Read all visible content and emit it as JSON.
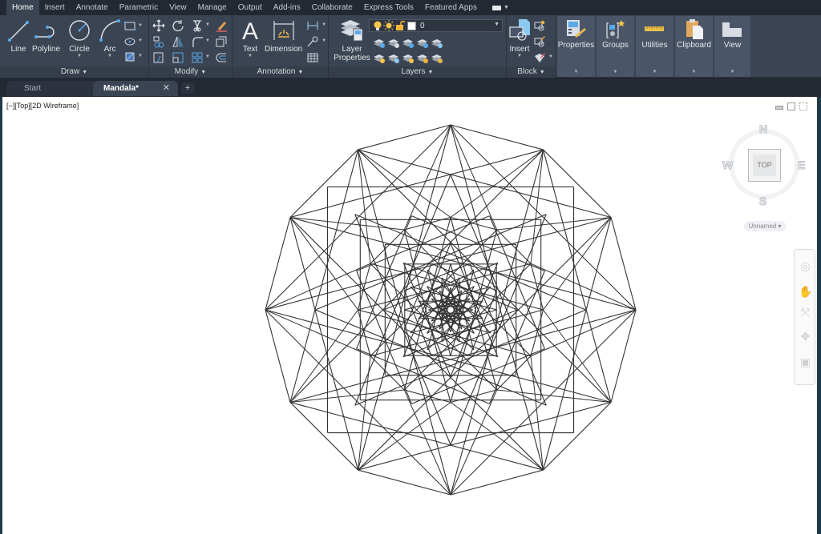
{
  "ribbon": {
    "tabs": [
      "Home",
      "Insert",
      "Annotate",
      "Parametric",
      "View",
      "Manage",
      "Output",
      "Add-ins",
      "Collaborate",
      "Express Tools",
      "Featured Apps"
    ],
    "active_tab": "Home",
    "panels": {
      "draw": {
        "title": "Draw",
        "buttons": [
          "Line",
          "Polyline",
          "Circle",
          "Arc"
        ]
      },
      "modify": {
        "title": "Modify"
      },
      "annotation": {
        "title": "Annotation",
        "buttons": [
          "Text",
          "Dimension"
        ]
      },
      "layers": {
        "title": "Layers",
        "layer_properties": "Layer Properties",
        "current_layer": "0",
        "current_layer_color": "#ffffff"
      },
      "block": {
        "title": "Block",
        "insert": "Insert"
      },
      "collapsed": [
        "Properties",
        "Groups",
        "Utilities",
        "Clipboard",
        "View"
      ]
    }
  },
  "file_tabs": {
    "start": "Start",
    "active": "Mandala*",
    "close_glyph": "✕",
    "new_glyph": "+"
  },
  "viewport": {
    "controls_label": "[−][Top][2D Wireframe]",
    "viewcube": {
      "face": "TOP",
      "north": "N",
      "south": "S",
      "east": "E",
      "west": "W",
      "ucs": "Unnamed"
    }
  },
  "drawing": {
    "name": "Mandala",
    "stroke_color": "#333333",
    "description": "Wireframe mandala: nested regular polygons (12, 8, 4 sides) with star diagonals converging toward the center",
    "layers": [
      {
        "sides": 12,
        "radius": 1.0,
        "rotation_deg": 0,
        "star_step": 1
      },
      {
        "sides": 12,
        "radius": 1.0,
        "rotation_deg": 0,
        "star_step": 3
      },
      {
        "sides": 12,
        "radius": 1.0,
        "rotation_deg": 0,
        "star_step": 5
      },
      {
        "sides": 4,
        "radius": 0.94,
        "rotation_deg": 45,
        "star_step": 1
      },
      {
        "sides": 8,
        "radius": 0.73,
        "rotation_deg": 0,
        "star_step": 3
      },
      {
        "sides": 4,
        "radius": 0.69,
        "rotation_deg": 45,
        "star_step": 1
      },
      {
        "sides": 8,
        "radius": 0.55,
        "rotation_deg": 22.5,
        "star_step": 2
      },
      {
        "sides": 12,
        "radius": 0.5,
        "rotation_deg": 0,
        "star_step": 1
      },
      {
        "sides": 12,
        "radius": 0.5,
        "rotation_deg": 0,
        "star_step": 5
      },
      {
        "sides": 4,
        "radius": 0.5,
        "rotation_deg": 45,
        "star_step": 1
      },
      {
        "sides": 8,
        "radius": 0.36,
        "rotation_deg": 0,
        "star_step": 3
      },
      {
        "sides": 4,
        "radius": 0.35,
        "rotation_deg": 45,
        "star_step": 1
      },
      {
        "sides": 8,
        "radius": 0.27,
        "rotation_deg": 22.5,
        "star_step": 2
      },
      {
        "sides": 12,
        "radius": 0.25,
        "rotation_deg": 0,
        "star_step": 5
      },
      {
        "sides": 12,
        "radius": 0.18,
        "rotation_deg": 15,
        "star_step": 5
      },
      {
        "sides": 12,
        "radius": 0.12,
        "rotation_deg": 0,
        "star_step": 5
      },
      {
        "sides": 12,
        "radius": 0.07,
        "rotation_deg": 15,
        "star_step": 5
      }
    ]
  }
}
